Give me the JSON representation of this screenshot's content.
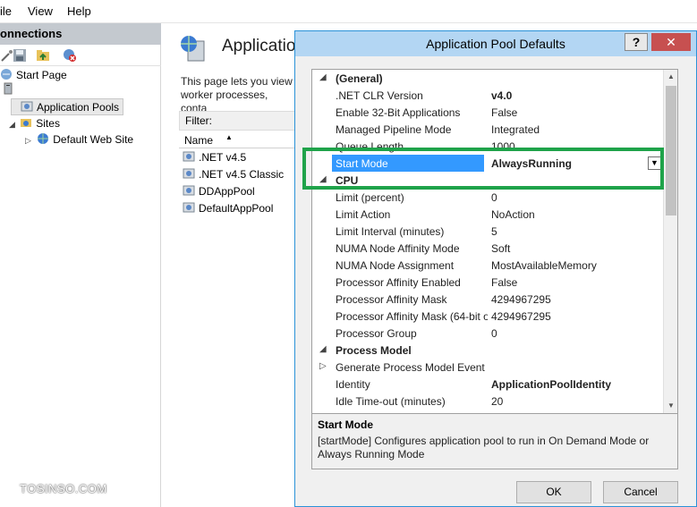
{
  "menubar": {
    "items": [
      "ile",
      "View",
      "Help"
    ]
  },
  "connections": {
    "header": "onnections",
    "tree": {
      "start_page": "Start Page",
      "app_pools": "Application Pools",
      "sites": "Sites",
      "default_site": "Default Web Site"
    }
  },
  "main": {
    "title": "Applicatio",
    "description": "This page lets you view worker processes, conta",
    "filter_label": "Filter:",
    "column_name": "Name",
    "pools": [
      ".NET v4.5",
      ".NET v4.5 Classic",
      "DDAppPool",
      "DefaultAppPool"
    ]
  },
  "dialog": {
    "title": "Application Pool Defaults",
    "help_label": "?",
    "close_label": "✕",
    "ok_label": "OK",
    "cancel_label": "Cancel",
    "rows": [
      {
        "type": "category",
        "name": "(General)",
        "expander": "◢"
      },
      {
        "name": ".NET CLR Version",
        "value": "v4.0",
        "bold": true
      },
      {
        "name": "Enable 32-Bit Applications",
        "value": "False"
      },
      {
        "name": "Managed Pipeline Mode",
        "value": "Integrated"
      },
      {
        "name": "Queue Length",
        "value": "1000"
      },
      {
        "name": "Start Mode",
        "value": "AlwaysRunning",
        "selected": true
      },
      {
        "type": "category",
        "name": "CPU",
        "expander": "◢"
      },
      {
        "name": "Limit (percent)",
        "value": "0"
      },
      {
        "name": "Limit Action",
        "value": "NoAction"
      },
      {
        "name": "Limit Interval (minutes)",
        "value": "5"
      },
      {
        "name": "NUMA Node Affinity Mode",
        "value": "Soft"
      },
      {
        "name": "NUMA Node Assignment",
        "value": "MostAvailableMemory"
      },
      {
        "name": "Processor Affinity Enabled",
        "value": "False"
      },
      {
        "name": "Processor Affinity Mask",
        "value": "4294967295"
      },
      {
        "name": "Processor Affinity Mask (64-bit o",
        "value": "4294967295"
      },
      {
        "name": "Processor Group",
        "value": "0"
      },
      {
        "type": "category",
        "name": "Process Model",
        "expander": "◢"
      },
      {
        "name": "Generate Process Model Event L",
        "value": "",
        "expander": "▷"
      },
      {
        "name": "Identity",
        "value": "ApplicationPoolIdentity",
        "bold": true
      },
      {
        "name": "Idle Time-out (minutes)",
        "value": "20"
      }
    ],
    "description_title": "Start Mode",
    "description_text": "[startMode] Configures application pool to run in On Demand Mode or Always Running Mode"
  },
  "watermark": "TOSINSO.COM",
  "colors": {
    "highlight": "#1fa34a",
    "selection": "#3399ff",
    "title_bar": "#b3d6f3",
    "close": "#c75050"
  }
}
